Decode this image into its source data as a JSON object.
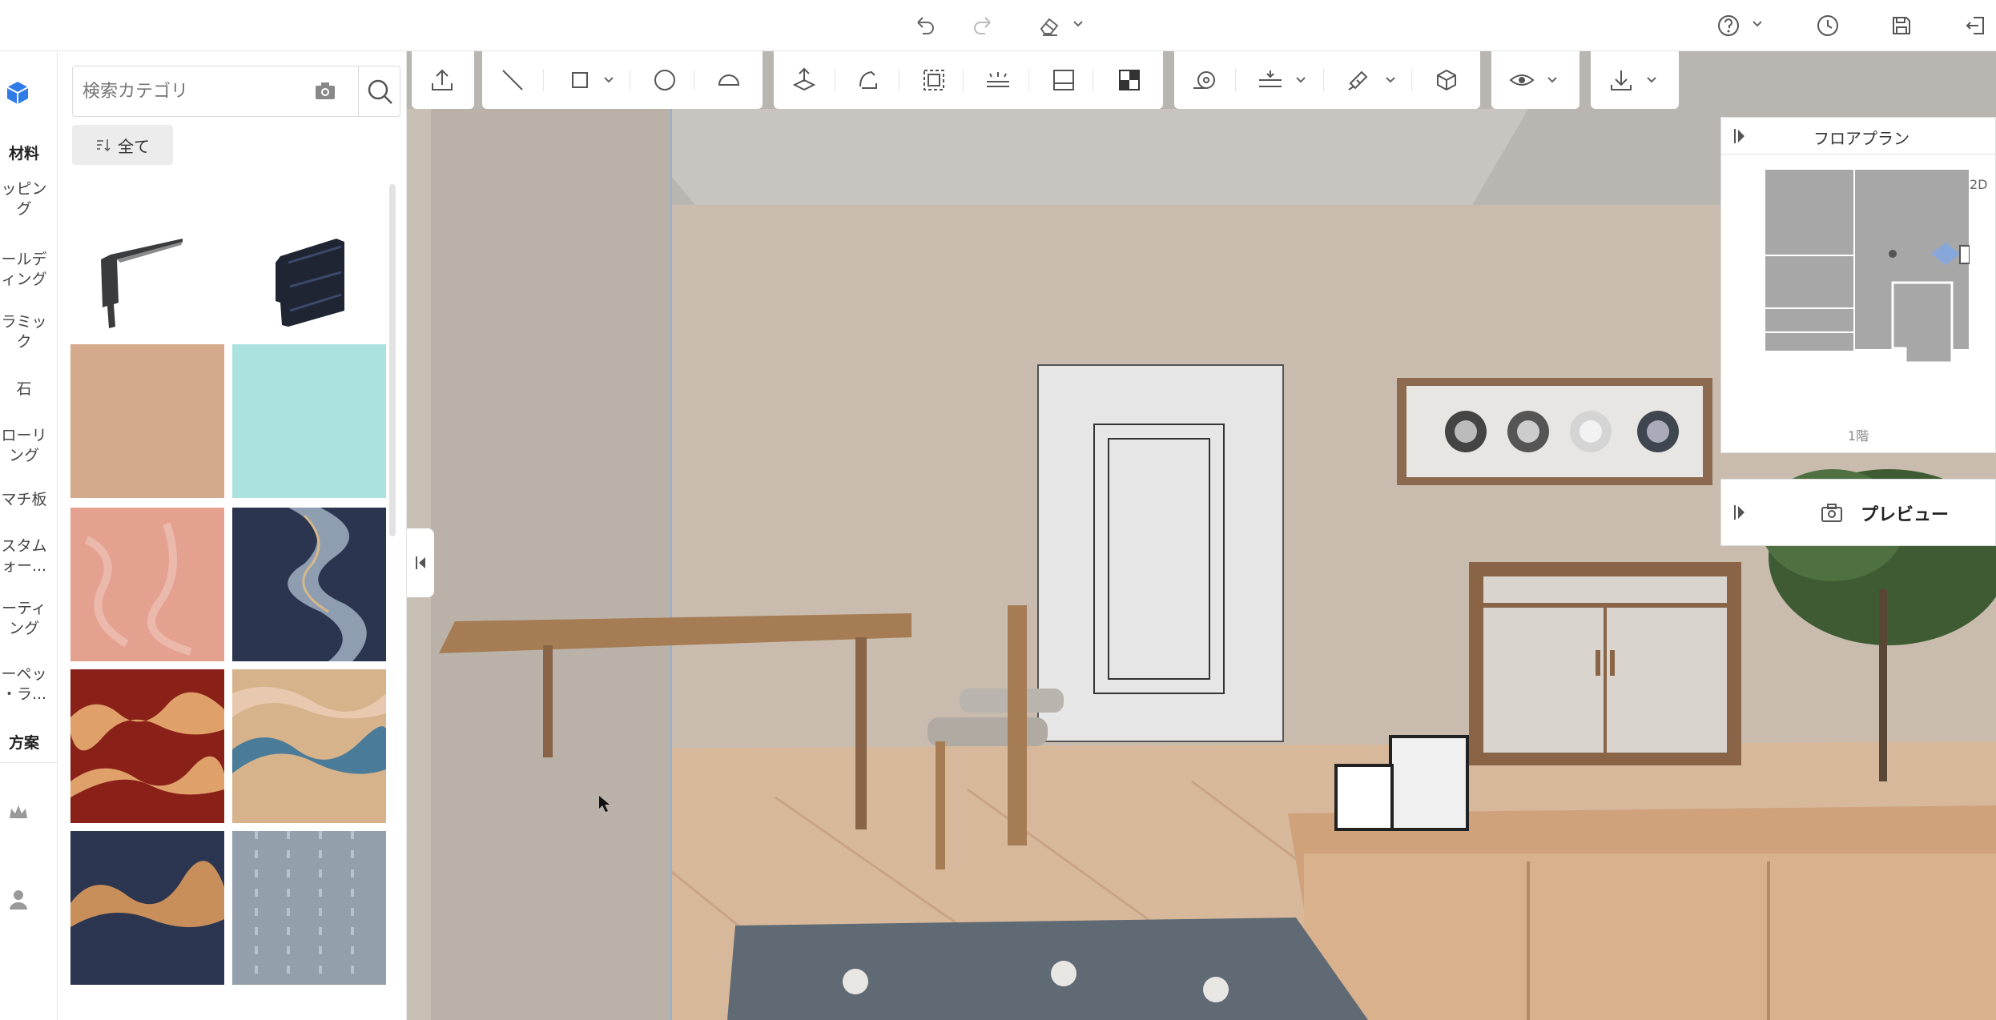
{
  "topbar": {
    "icons": [
      "undo-icon",
      "redo-icon",
      "eraser-icon",
      "help-icon",
      "history-icon",
      "save-icon",
      "exit-icon"
    ]
  },
  "rail": {
    "items": [
      {
        "label": "材料",
        "bold": true
      },
      {
        "label": "ッピン\nグ"
      },
      {
        "label": "ールデ\nィング"
      },
      {
        "label": "ラミッ\nク"
      },
      {
        "label": "石"
      },
      {
        "label": "ローリ\nング"
      },
      {
        "label": "マチ板"
      },
      {
        "label": "スタム\nォー..."
      },
      {
        "label": "ーティ\nング"
      },
      {
        "label": "ーペッ\n・ラ..."
      },
      {
        "label": "方案",
        "bold": true
      }
    ]
  },
  "panel": {
    "search_placeholder": "検索カテゴリ",
    "filter_label": "全て",
    "tiles": [
      {
        "name": "molding-profile-gray",
        "color": "#ffffff"
      },
      {
        "name": "molding-profile-navy",
        "color": "#ffffff"
      },
      {
        "name": "tile-beige",
        "color": "#d4a98c"
      },
      {
        "name": "tile-aqua",
        "color": "#abe2e0"
      },
      {
        "name": "tile-pink",
        "color": "#e4a18f"
      },
      {
        "name": "tile-navy-marble",
        "color": "#2b3550"
      },
      {
        "name": "tile-red-landscape",
        "color": "#8a2119"
      },
      {
        "name": "tile-tan-landscape",
        "color": "#d7b38b"
      },
      {
        "name": "tile-navy-landscape",
        "color": "#2d3650"
      },
      {
        "name": "tile-gray-texture",
        "color": "#93a0ab"
      }
    ]
  },
  "floorplan": {
    "title": "フロアプラン",
    "mode": "2D",
    "floor": "1階"
  },
  "preview": {
    "label": "プレビュー"
  },
  "colors": {
    "wall": "#c9bcae",
    "floor": "#d8b89a",
    "accent": "#2f7be8"
  }
}
